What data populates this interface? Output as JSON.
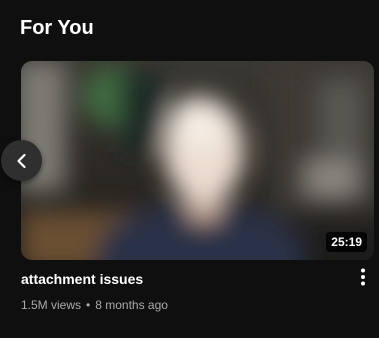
{
  "section": {
    "title": "For You"
  },
  "video": {
    "title": "attachment issues",
    "duration": "25:19",
    "views": "1.5M views",
    "separator": "•",
    "age": "8 months ago"
  },
  "icons": {
    "prev": "chevron-left-icon",
    "more": "more-vertical-icon"
  },
  "colors": {
    "background": "#0f0f0f",
    "title_text": "#ffffff",
    "meta_text": "#aaaaaa"
  }
}
